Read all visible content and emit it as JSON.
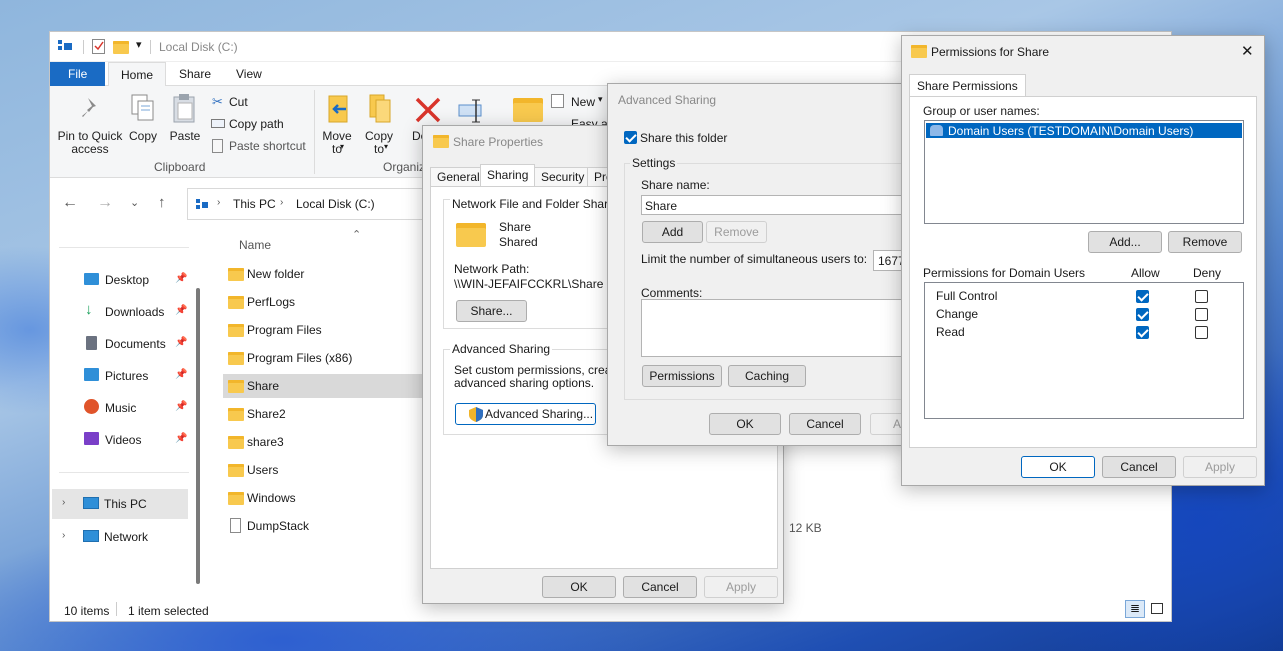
{
  "explorer": {
    "title": "Local Disk (C:)",
    "tabs": [
      "File",
      "Home",
      "Share",
      "View"
    ],
    "clipboard": {
      "pin_label": "Pin to Quick access",
      "copy_label": "Copy",
      "paste_label": "Paste",
      "cut_label": "Cut",
      "copy_path_label": "Copy path",
      "paste_shortcut_label": "Paste shortcut",
      "group_label": "Clipboard"
    },
    "organize": {
      "move_to_label": "Move to",
      "copy_to_label": "Copy to",
      "delete_label": "De",
      "group_label": "Organiz"
    },
    "new_group": {
      "new_item_label": "New",
      "easy_access_label": "Easy ac"
    },
    "breadcrumb": [
      "This PC",
      "Local Disk (C:)"
    ],
    "column_name": "Name",
    "nav": {
      "quick": [
        {
          "label": "Desktop",
          "icon": "desktop-icon",
          "color": "#2f8fd8"
        },
        {
          "label": "Downloads",
          "icon": "download-icon",
          "color": "#18a05a"
        },
        {
          "label": "Documents",
          "icon": "documents-icon",
          "color": "#6b7280"
        },
        {
          "label": "Pictures",
          "icon": "pictures-icon",
          "color": "#2f8fd8"
        },
        {
          "label": "Music",
          "icon": "music-icon",
          "color": "#e0542a"
        },
        {
          "label": "Videos",
          "icon": "videos-icon",
          "color": "#7a3fc8"
        }
      ],
      "this_pc": "This PC",
      "network": "Network"
    },
    "files": [
      "New folder",
      "PerfLogs",
      "Program Files",
      "Program Files (x86)",
      "Share",
      "Share2",
      "share3",
      "Users",
      "Windows",
      "DumpStack"
    ],
    "selected_file": "Share",
    "dumpstack_size": "12 KB",
    "status": {
      "items": "10 items",
      "selected": "1 item selected"
    }
  },
  "share_properties": {
    "title": "Share Properties",
    "tabs": [
      "General",
      "Sharing",
      "Security",
      "Previ"
    ],
    "active_tab": "Sharing",
    "nfs_group": "Network File and Folder Sharing",
    "share_name": "Share",
    "share_status": "Shared",
    "network_path_label": "Network Path:",
    "network_path": "\\\\WIN-JEFAIFCCKRL\\Share",
    "share_button": "Share...",
    "adv_group": "Advanced Sharing",
    "adv_desc_1": "Set custom permissions, create m",
    "adv_desc_2": "advanced sharing options.",
    "adv_button": "Advanced Sharing...",
    "ok": "OK",
    "cancel": "Cancel",
    "apply": "Apply"
  },
  "advanced_sharing": {
    "title": "Advanced Sharing",
    "share_this_folder": "Share this folder",
    "share_checked": true,
    "settings_label": "Settings",
    "share_name_label": "Share name:",
    "share_name_value": "Share",
    "add": "Add",
    "remove": "Remove",
    "limit_label": "Limit the number of simultaneous users to:",
    "limit_value": "1677",
    "comments_label": "Comments:",
    "permissions": "Permissions",
    "caching": "Caching",
    "ok": "OK",
    "cancel": "Cancel",
    "apply": "Ap"
  },
  "permissions": {
    "title": "Permissions for Share",
    "tab": "Share Permissions",
    "group_label": "Group or user names:",
    "users": [
      "Domain Users (TESTDOMAIN\\Domain Users)"
    ],
    "add": "Add...",
    "remove": "Remove",
    "perm_label": "Permissions for Domain Users",
    "allow": "Allow",
    "deny": "Deny",
    "rows": [
      {
        "name": "Full Control",
        "allow": true,
        "deny": false
      },
      {
        "name": "Change",
        "allow": true,
        "deny": false
      },
      {
        "name": "Read",
        "allow": true,
        "deny": false
      }
    ],
    "ok": "OK",
    "cancel": "Cancel",
    "apply": "Apply",
    "close_glyph": "✕"
  }
}
